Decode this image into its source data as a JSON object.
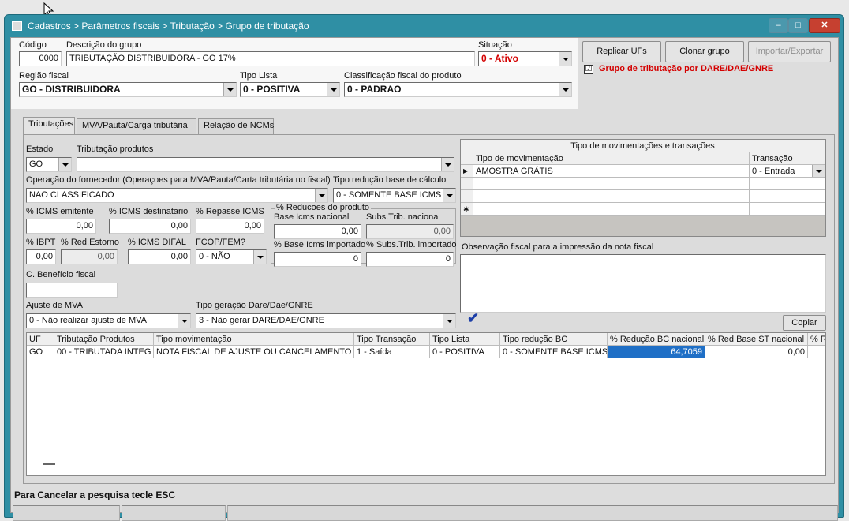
{
  "window": {
    "title": "Cadastros > Parâmetros fiscais > Tributação > Grupo de tributação",
    "minimize_glyph": "–",
    "maximize_glyph": "□",
    "close_glyph": "✕"
  },
  "header": {
    "codigo": {
      "label": "Código",
      "value": "0000"
    },
    "descricao": {
      "label": "Descrição do grupo",
      "value": "TRIBUTAÇÃO DISTRIBUIDORA - GO 17%"
    },
    "situacao": {
      "label": "Situação",
      "value": "0 - Ativo"
    },
    "regiao_fiscal": {
      "label": "Região fiscal",
      "value": "GO - DISTRIBUIDORA"
    },
    "tipo_lista": {
      "label": "Tipo Lista",
      "value": "0 - POSITIVA"
    },
    "classificacao": {
      "label": "Classificação fiscal do produto",
      "value": "0 - PADRAO"
    }
  },
  "actions": {
    "replicar": "Replicar UFs",
    "clonar": "Clonar grupo",
    "importar": "Importar/Exportar",
    "dare_check_label": "Grupo de tributação por DARE/DAE/GNRE",
    "dare_checked": "☑"
  },
  "tabs": [
    {
      "label": "Tributações"
    },
    {
      "label": "MVA/Pauta/Carga tributária"
    },
    {
      "label": "Relação de NCMs"
    }
  ],
  "form": {
    "estado": {
      "label": "Estado",
      "value": "GO"
    },
    "tributacao_produtos": {
      "label": "Tributação produtos",
      "value": ""
    },
    "operacao_fornecedor": {
      "label": "Operação do fornecedor (Operaçoes para MVA/Pauta/Carta tributária no fiscal)",
      "value": "NAO CLASSIFICADO"
    },
    "tipo_reducao": {
      "label": "Tipo redução base de cálculo",
      "value": "0 - SOMENTE BASE ICMS"
    },
    "icms_emitente": {
      "label": "% ICMS emitente",
      "value": "0,00"
    },
    "icms_destinatario": {
      "label": "% ICMS destinatario",
      "value": "0,00"
    },
    "repasse_icms": {
      "label": "% Repasse ICMS",
      "value": "0,00"
    },
    "reducoes_group": "% Reducoes do produto",
    "base_icms_nacional": {
      "label": "Base Icms nacional",
      "value": "0,00"
    },
    "subs_trib_nacional": {
      "label": "Subs.Trib. nacional",
      "value": "0,00"
    },
    "base_icms_importado": {
      "label": "% Base Icms importado",
      "value": "0"
    },
    "subs_trib_importado": {
      "label": "% Subs.Trib. importado",
      "value": "0"
    },
    "ibpt": {
      "label": "% IBPT",
      "value": "0,00"
    },
    "red_estorno": {
      "label": "% Red.Estorno",
      "value": "0,00"
    },
    "icms_difal": {
      "label": "% ICMS DIFAL",
      "value": "0,00"
    },
    "fcop": {
      "label": "FCOP/FEM?",
      "value": "0 - NÃO"
    },
    "beneficio": {
      "label": "C. Benefício fiscal",
      "value": ""
    },
    "ajuste_mva": {
      "label": "Ajuste de MVA",
      "value": "0 - Não realizar ajuste de MVA"
    },
    "tipo_geracao": {
      "label": "Tipo geração Dare/Dae/GNRE",
      "value": "3 - Não gerar DARE/DAE/GNRE"
    }
  },
  "movimentacoes": {
    "title": "Tipo de movimentações e transações",
    "col_tipo": "Tipo de movimentação",
    "col_transacao": "Transação",
    "row_marker": "▶",
    "new_marker": "✱",
    "rows": [
      {
        "tipo": "AMOSTRA GRÁTIS",
        "transacao": "0 - Entrada"
      }
    ]
  },
  "observacao": {
    "label": "Observação fiscal para a impressão da nota fiscal",
    "value": ""
  },
  "confirm_glyph": "✔",
  "copiar": "Copiar",
  "grid": {
    "headers": [
      "UF",
      "Tributação Produtos",
      "Tipo movimentação",
      "Tipo Transação",
      "Tipo Lista",
      "Tipo redução BC",
      "% Redução BC nacional",
      "% Red Base ST nacional",
      "% Re"
    ],
    "rows": [
      [
        "GO",
        "00 - TRIBUTADA INTEG",
        "NOTA FISCAL DE AJUSTE OU CANCELAMENTO",
        "1 - Saída",
        "0 - POSITIVA",
        "0 - SOMENTE BASE ICMS",
        "64,7059",
        "0,00",
        ""
      ]
    ]
  },
  "status_message": "Para Cancelar a pesquisa tecle ESC",
  "colors": {
    "title_bar": "#2f8fa4",
    "status_red": "#d40000",
    "selection": "#1f6fc6"
  }
}
